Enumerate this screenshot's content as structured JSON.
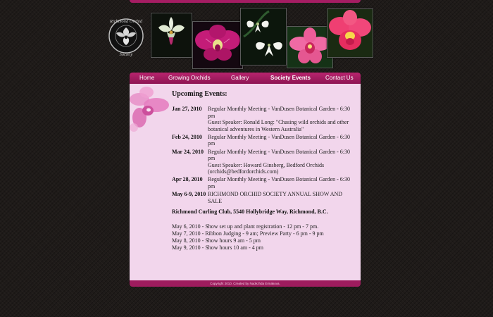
{
  "logo": {
    "text_top": "Richmond Orchid",
    "text_bottom": "Society"
  },
  "nav": {
    "items": [
      {
        "label": "Home"
      },
      {
        "label": "Growing Orchids"
      },
      {
        "label": "Gallery"
      },
      {
        "label": "Society Events"
      },
      {
        "label": "Contact Us"
      }
    ],
    "active": "Society Events"
  },
  "content": {
    "heading": "Upcoming Events:",
    "events": [
      {
        "date": "Jan 27, 2010",
        "lines": [
          "Regular Monthly Meeting - VanDusen Botanical Garden - 6:30 pm",
          "Guest Speaker: Ronald Long: \"Chasing wild orchids and other botanical adventures in Western Australia\""
        ]
      },
      {
        "date": "Feb 24, 2010",
        "lines": [
          "Regular Monthly Meeting - VanDusen Botanical Garden - 6:30 pm"
        ]
      },
      {
        "date": "Mar 24, 2010",
        "lines": [
          "Regular Monthly Meeting - VanDusen Botanical Garden - 6:30 pm",
          "Guest Speaker: Howard Ginsberg, Bedford Orchids (orchids@bedfordorchids.com)"
        ]
      },
      {
        "date": "Apr 28, 2010",
        "lines": [
          "Regular Monthly Meeting - VanDusen Botanical Garden - 6:30 pm"
        ]
      },
      {
        "date": "May 6-9, 2010",
        "lines": [
          "RICHMOND ORCHID SOCIETY ANNUAL SHOW AND SALE"
        ]
      }
    ],
    "venue": "Richmond Curling Club, 5540 Hollybridge Way, Richmond, B.C.",
    "schedule": [
      "May 6, 2010 - Show set up and plant registration - 12 pm - 7 pm.",
      "May 7, 2010 - Ribbon Judging - 9 am; Preview Party - 6 pm - 9 pm",
      "May 8, 2010 - Show hours 9 am - 5 pm",
      "May 9, 2010 - Show hours 10 am - 4 pm"
    ]
  },
  "footer": {
    "text": "Copyright 2010. Created by Nadezhda Ermakova."
  },
  "colors": {
    "background": "#1f1b19",
    "accent": "#a51d63",
    "content_bg": "#f2d6ec"
  },
  "icons": [
    "orchid-society-logo",
    "orchid-photo-white",
    "orchid-photo-magenta",
    "orchid-photo-white-egret",
    "orchid-photo-pink",
    "orchid-photo-red-pink",
    "orchid-decoration"
  ]
}
